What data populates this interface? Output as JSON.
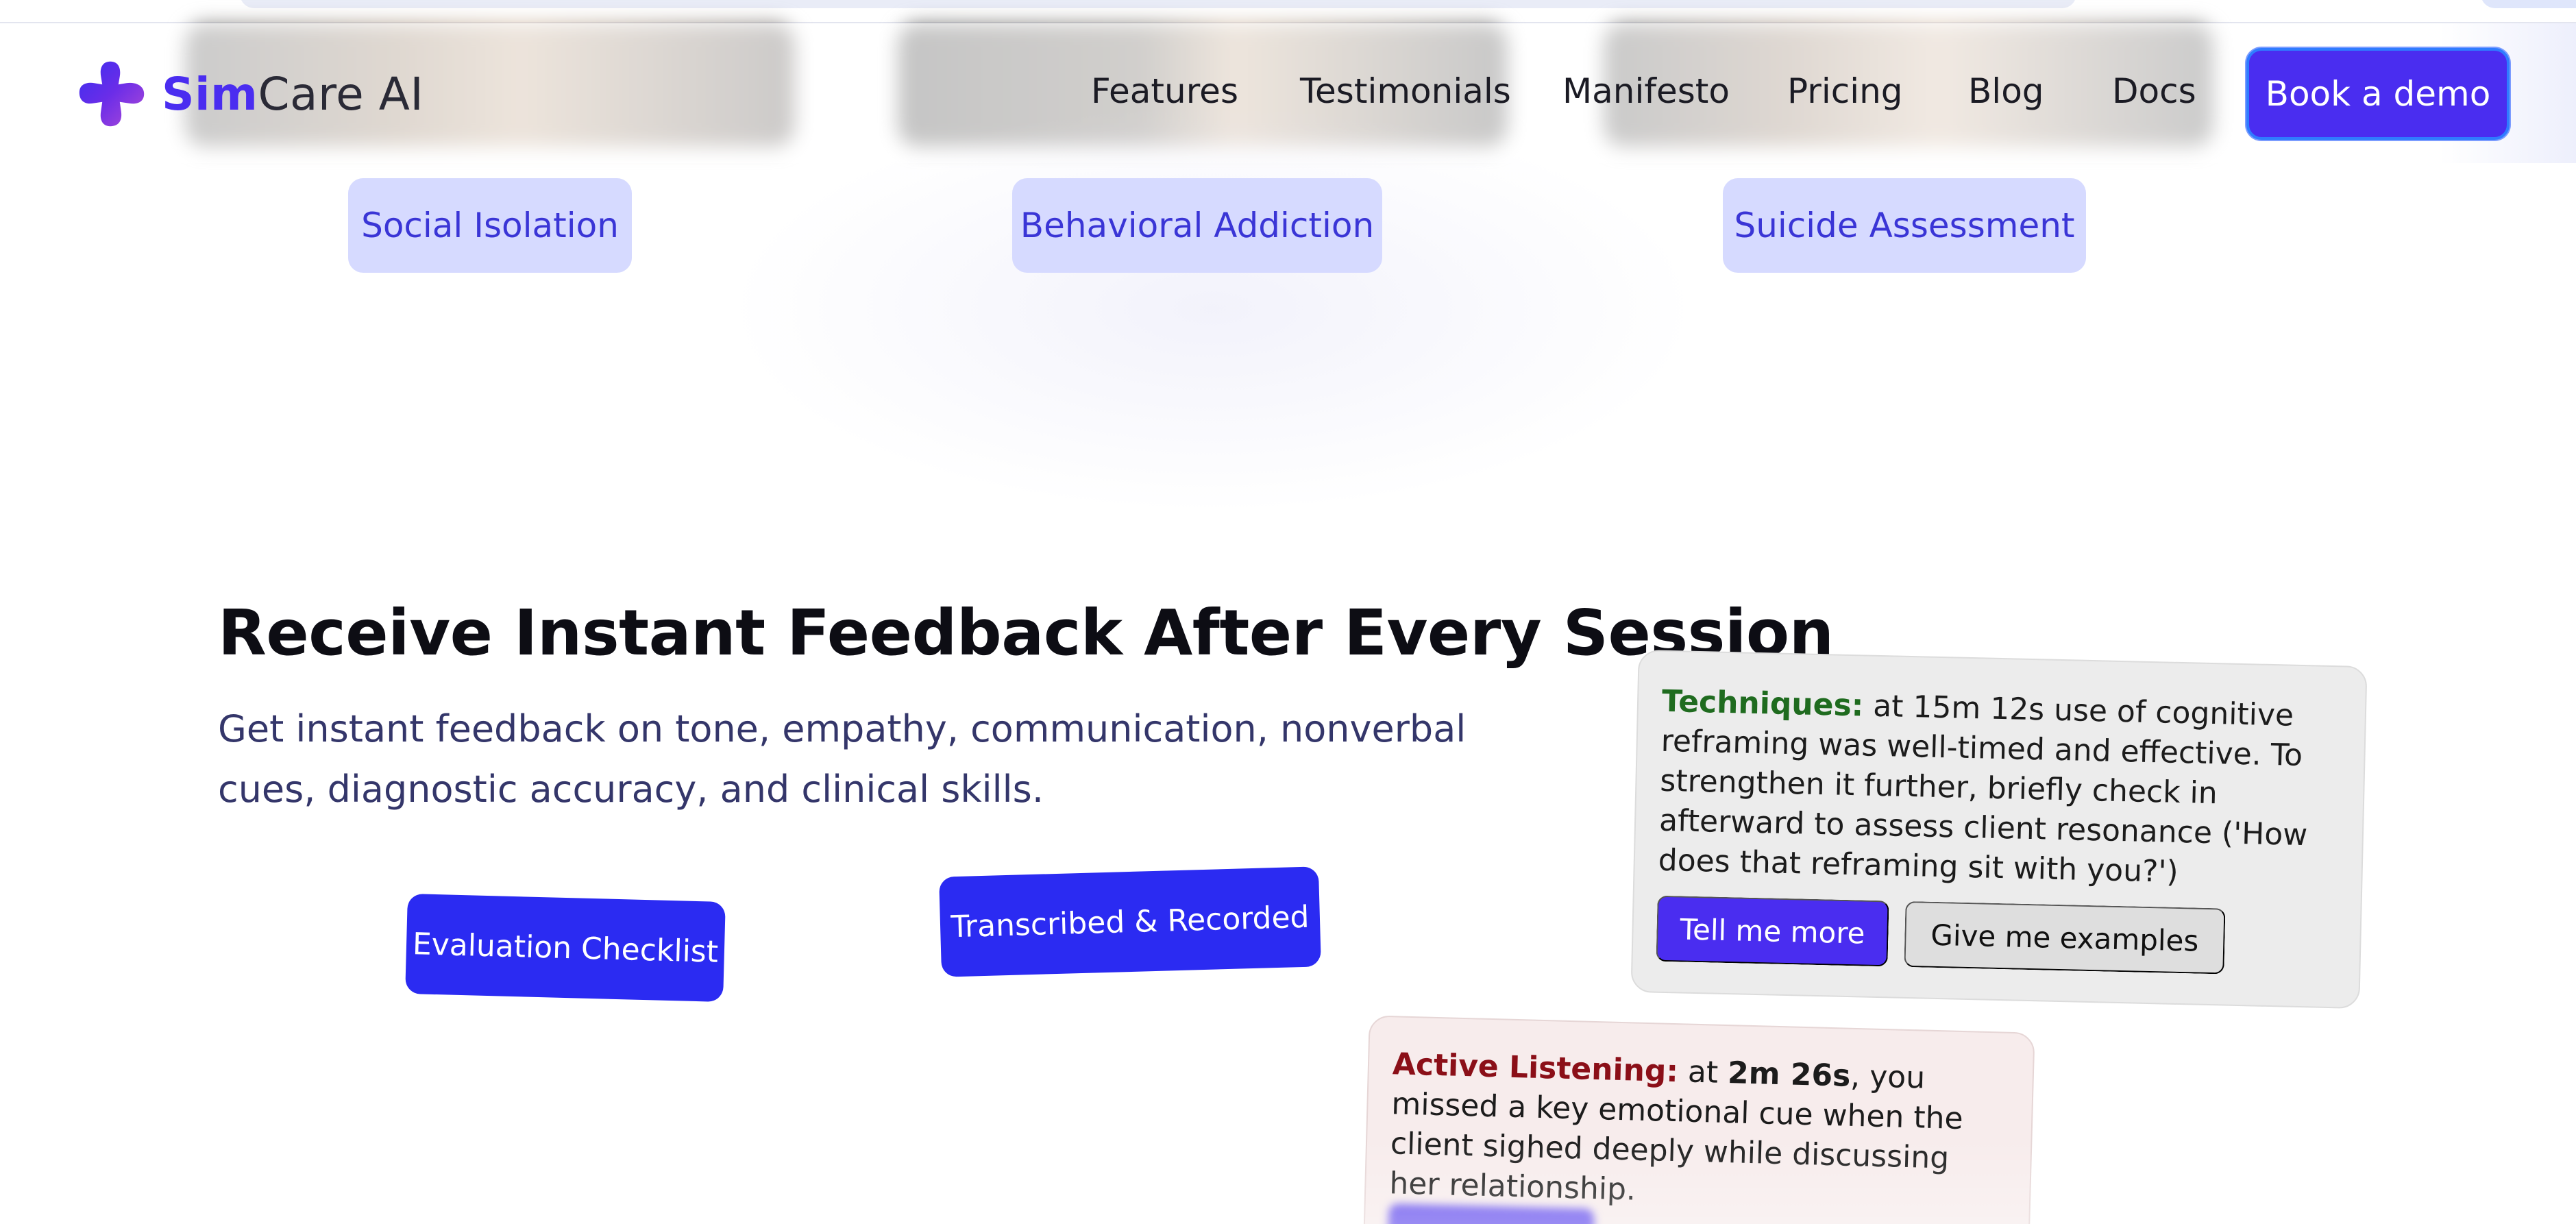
{
  "header": {
    "logo": {
      "prefix": "Sim",
      "rest": "Care AI",
      "icon": "simcare-logo-icon"
    },
    "nav": {
      "features": "Features",
      "testimonials": "Testimonials",
      "manifesto": "Manifesto",
      "pricing": "Pricing",
      "blog": "Blog",
      "docs": "Docs"
    },
    "cta": "Book a demo"
  },
  "topics": {
    "social_isolation": "Social Isolation",
    "behavioral_addiction": "Behavioral Addiction",
    "suicide_assessment": "Suicide Assessment"
  },
  "feedback_section": {
    "title": "Receive Instant Feedback After Every Session",
    "subtitle": "Get instant feedback on tone, empathy, communication, nonverbal cues, diagnostic accuracy, and clinical skills.",
    "pills": {
      "evaluation": "Evaluation Checklist",
      "transcribed": "Transcribed & Recorded"
    }
  },
  "cards": {
    "techniques": {
      "label": "Techniques:",
      "body": " at 15m 12s use of cognitive reframing was well-timed and effective. To strengthen it further, briefly check in afterward to assess client resonance ('How does that reframing sit with you?')",
      "more": "Tell me more",
      "examples": "Give me examples"
    },
    "active_listening": {
      "label": "Active Listening:",
      "pre": " at ",
      "time": "2m 26s",
      "post": ", you missed a key emotional cue when the client sighed deeply while discussing her relationship."
    }
  },
  "colors": {
    "brand": "#4a2df0",
    "pill_blue": "#2b2bf2",
    "chip_bg": "#d6daff",
    "chip_text": "#3a35d6",
    "techniques_label": "#1f6b1f",
    "listening_label": "#8b0f18"
  }
}
